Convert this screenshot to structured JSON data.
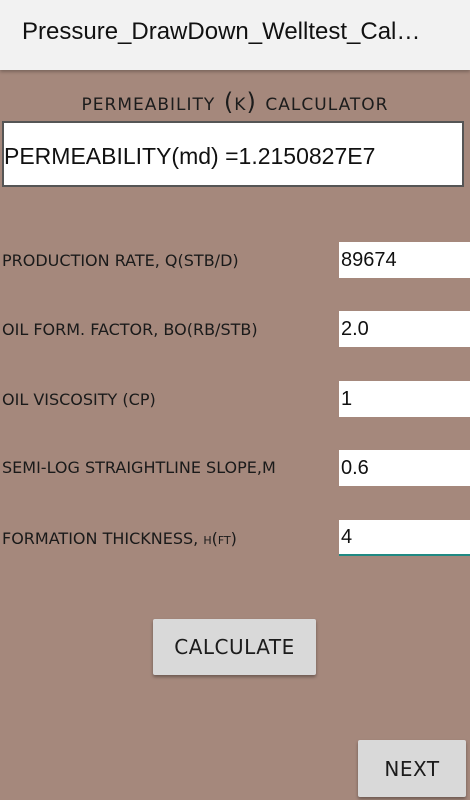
{
  "app": {
    "title": "Pressure_DrawDown_Welltest_Cal…"
  },
  "calculator": {
    "heading": "PERMEABILITY (K) CALCULATOR",
    "result": "PERMEABILITY(md) =1.2150827E7"
  },
  "fields": [
    {
      "label": "PRODUCTION RATE, Q(STB/D)",
      "value": "89674"
    },
    {
      "label": "OIL FORM. FACTOR, BO(RB/STB)",
      "value": "2.0"
    },
    {
      "label": "OIL VISCOSITY (CP)",
      "value": "1"
    },
    {
      "label": "SEMI-LOG STRAIGHTLINE SLOPE,M",
      "value": "0.6"
    },
    {
      "label": "FORMATION THICKNESS, h(ft)",
      "value": "4"
    }
  ],
  "buttons": {
    "calculate": "CALCULATE",
    "next": "NEXT"
  },
  "colors": {
    "background": "#a5887c",
    "titlebar": "#f2f2f2",
    "focus_underline": "#1f8a83"
  }
}
